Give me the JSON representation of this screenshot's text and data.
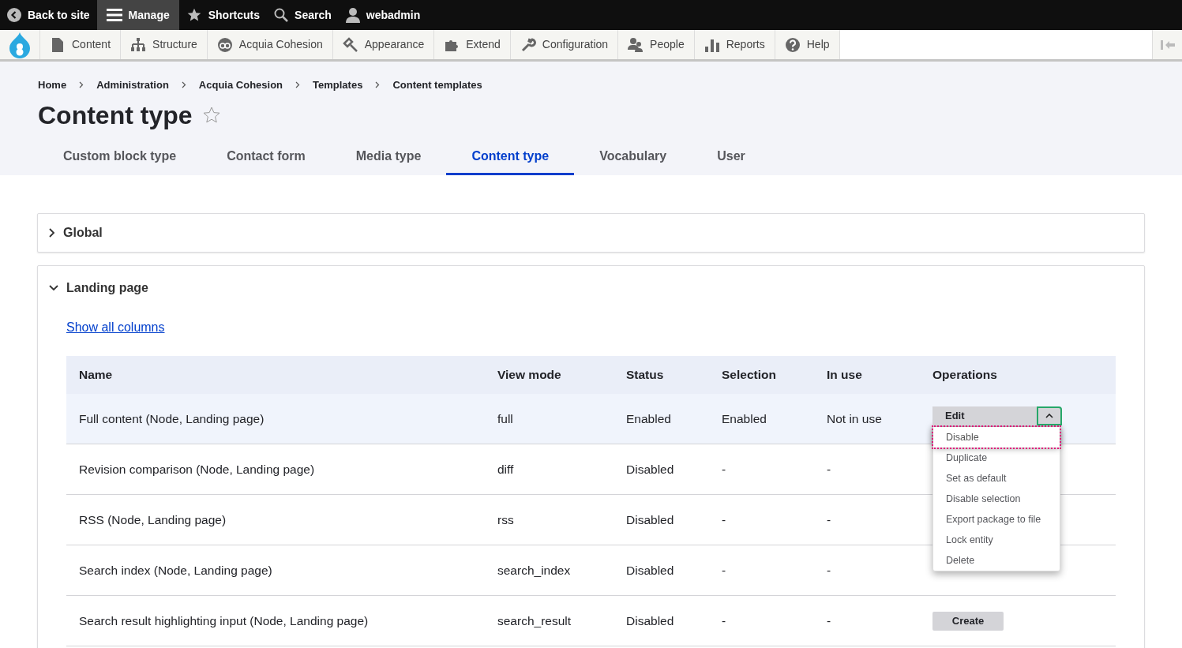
{
  "toolbar": {
    "items": [
      {
        "label": "Back to site",
        "kind": "back",
        "selected": false
      },
      {
        "label": "Manage",
        "kind": "menu",
        "selected": true
      },
      {
        "label": "Shortcuts",
        "kind": "star",
        "selected": false
      },
      {
        "label": "Search",
        "kind": "search",
        "selected": false
      },
      {
        "label": "webadmin",
        "kind": "user",
        "selected": false
      }
    ]
  },
  "admin_menu": {
    "items": [
      {
        "label": "Content",
        "kind": "content"
      },
      {
        "label": "Structure",
        "kind": "structure"
      },
      {
        "label": "Acquia Cohesion",
        "kind": "cohesion"
      },
      {
        "label": "Appearance",
        "kind": "appearance"
      },
      {
        "label": "Extend",
        "kind": "extend"
      },
      {
        "label": "Configuration",
        "kind": "configuration"
      },
      {
        "label": "People",
        "kind": "people"
      },
      {
        "label": "Reports",
        "kind": "reports"
      },
      {
        "label": "Help",
        "kind": "help"
      }
    ]
  },
  "breadcrumb": [
    "Home",
    "Administration",
    "Acquia Cohesion",
    "Templates",
    "Content templates"
  ],
  "title": "Content type",
  "tabs": [
    {
      "label": "Custom block type",
      "selected": false
    },
    {
      "label": "Contact form",
      "selected": false
    },
    {
      "label": "Media type",
      "selected": false
    },
    {
      "label": "Content type",
      "selected": true
    },
    {
      "label": "Vocabulary",
      "selected": false
    },
    {
      "label": "User",
      "selected": false
    }
  ],
  "sections": [
    {
      "title": "Global",
      "expanded": false
    },
    {
      "title": "Landing page",
      "expanded": true,
      "link": "Show all columns",
      "table": {
        "columns": [
          "Name",
          "View mode",
          "Status",
          "Selection",
          "In use",
          "Operations"
        ],
        "rows": [
          {
            "selected": true,
            "cells": [
              "Full content (Node, Landing page)",
              "full",
              "Enabled",
              "Enabled",
              "Not in use"
            ],
            "operation": "Edit",
            "menu": [
              {
                "label": "Disable",
                "focused": true
              },
              {
                "label": "Duplicate",
                "focused": false
              },
              {
                "label": "Set as default",
                "focused": false
              },
              {
                "label": "Disable selection",
                "focused": false
              },
              {
                "label": "Export package to file",
                "focused": false
              },
              {
                "label": "Lock entity",
                "focused": false
              },
              {
                "label": "Delete",
                "focused": false
              }
            ]
          },
          {
            "selected": false,
            "cells": [
              "Revision comparison (Node, Landing page)",
              "diff",
              "Disabled",
              "-",
              "-"
            ]
          },
          {
            "selected": false,
            "cells": [
              "RSS (Node, Landing page)",
              "rss",
              "Disabled",
              "-",
              "-"
            ]
          },
          {
            "selected": false,
            "cells": [
              "Search index (Node, Landing page)",
              "search_index",
              "Disabled",
              "-",
              "-"
            ]
          },
          {
            "selected": false,
            "cells": [
              "Search result highlighting input (Node, Landing page)",
              "search_result",
              "Disabled",
              "-",
              "-"
            ],
            "operation": "Create"
          }
        ]
      }
    }
  ]
}
